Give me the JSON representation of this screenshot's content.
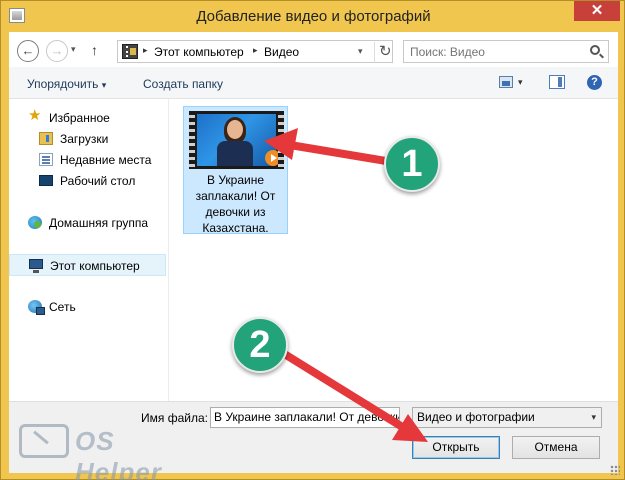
{
  "window": {
    "title": "Добавление видео и фотографий",
    "close_glyph": "✕"
  },
  "nav": {
    "back_glyph": "←",
    "forward_glyph": "→",
    "recent_glyph": "▾",
    "up_glyph": "↑"
  },
  "address": {
    "crumbs": [
      "Этот компьютер",
      "Видео"
    ],
    "separator_glyph": "▸",
    "dropdown_glyph": "▾",
    "refresh_glyph": "↻"
  },
  "search": {
    "placeholder": "Поиск: Видео"
  },
  "toolbar": {
    "organize_label": "Упорядочить",
    "organize_caret": "▾",
    "new_folder_label": "Создать папку",
    "view_caret": "▾",
    "help_glyph": "?"
  },
  "sidebar": {
    "items": [
      {
        "label": "Избранное",
        "icon": "star-icon"
      },
      {
        "label": "Загрузки",
        "icon": "downloads-folder-icon"
      },
      {
        "label": "Недавние места",
        "icon": "recent-places-icon"
      },
      {
        "label": "Рабочий стол",
        "icon": "desktop-icon"
      },
      {
        "label": "Домашняя группа",
        "icon": "homegroup-icon"
      },
      {
        "label": "Этот компьютер",
        "icon": "computer-icon",
        "selected": true
      },
      {
        "label": "Сеть",
        "icon": "network-icon"
      }
    ],
    "star_glyph": "★"
  },
  "files": [
    {
      "name": "В Украине заплакали! От девочки из Казахстана.",
      "type": "video"
    }
  ],
  "footer": {
    "filename_label": "Имя файла:",
    "filename_value": "В Украине заплакали! От девочки из Казахстана.",
    "filetype_value": "Видео и фотографии",
    "filetype_caret": "▾",
    "open_label": "Открыть",
    "cancel_label": "Отмена"
  },
  "watermark": {
    "text": "OS Helper"
  },
  "annotations": {
    "badge_1": "1",
    "badge_2": "2",
    "arrow_color": "#e5383b",
    "badge_color": "#22a37a"
  }
}
